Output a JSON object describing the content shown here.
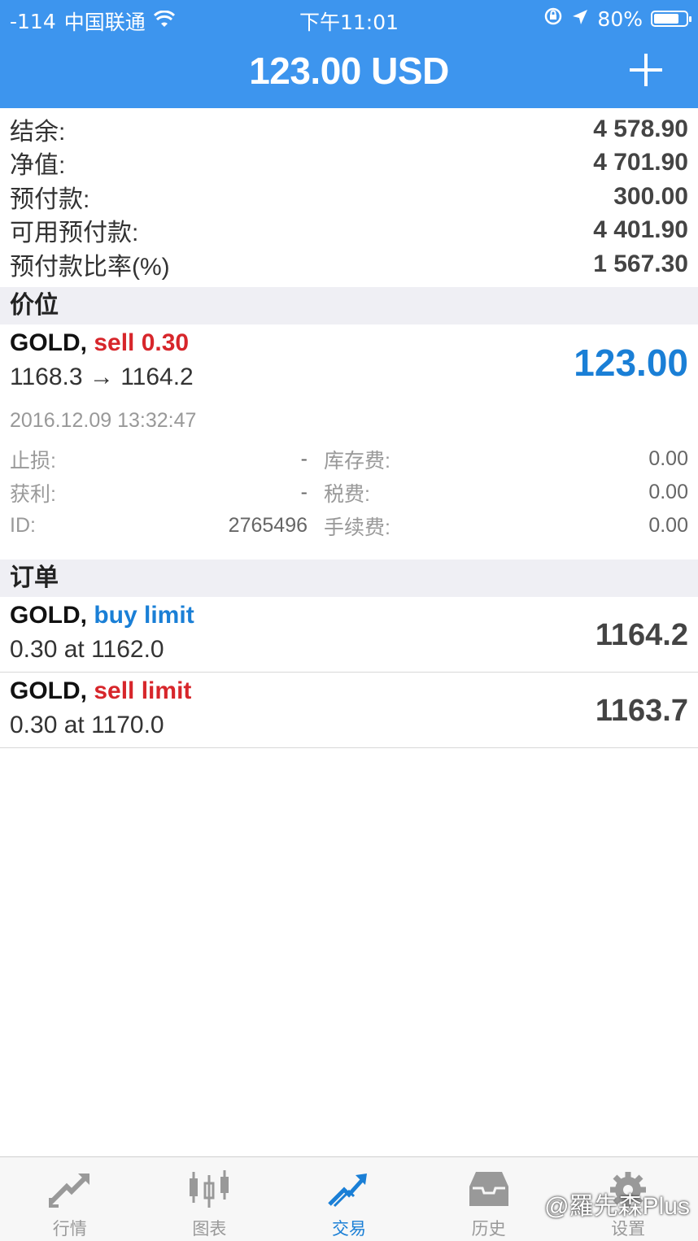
{
  "status_bar": {
    "signal": "-114",
    "carrier": "中国联通",
    "time": "下午11:01",
    "battery": "80%",
    "battery_level": 0.8
  },
  "header": {
    "title": "123.00 USD"
  },
  "summary": [
    {
      "label": "结余:",
      "value": "4 578.90"
    },
    {
      "label": "净值:",
      "value": "4 701.90"
    },
    {
      "label": "预付款:",
      "value": "300.00"
    },
    {
      "label": "可用预付款:",
      "value": "4 401.90"
    },
    {
      "label": "预付款比率(%)",
      "value": "1 567.30"
    }
  ],
  "positions_section": {
    "title": "价位"
  },
  "position": {
    "symbol": "GOLD,",
    "action": "sell 0.30",
    "prices": "1168.3 → 1164.2",
    "profit": "123.00",
    "time": "2016.12.09 13:32:47",
    "details": [
      {
        "label_l": "止损:",
        "value_l": "-",
        "label_r": "库存费:",
        "value_r": "0.00"
      },
      {
        "label_l": "获利:",
        "value_l": "-",
        "label_r": "税费:",
        "value_r": "0.00"
      },
      {
        "label_l": "ID:",
        "value_l": "2765496",
        "label_r": "手续费:",
        "value_r": "0.00"
      }
    ]
  },
  "orders_section": {
    "title": "订单"
  },
  "orders": [
    {
      "symbol": "GOLD,",
      "type": "buy limit",
      "sub": "0.30 at 1162.0",
      "price": "1164.2",
      "color": "#1a7fd6"
    },
    {
      "symbol": "GOLD,",
      "type": "sell limit",
      "sub": "0.30 at 1170.0",
      "price": "1163.7",
      "color": "#d7262b"
    }
  ],
  "tabs": [
    {
      "label": "行情",
      "icon": "quotes-icon"
    },
    {
      "label": "图表",
      "icon": "chart-candles-icon"
    },
    {
      "label": "交易",
      "icon": "trade-icon"
    },
    {
      "label": "历史",
      "icon": "history-inbox-icon"
    },
    {
      "label": "设置",
      "icon": "settings-gear-icon"
    }
  ],
  "watermark": "@羅先森Plus",
  "colors": {
    "header_bg": "#3d95ee",
    "sell": "#d7262b",
    "buy": "#1a7fd6",
    "active_tab": "#1a7fd6"
  }
}
